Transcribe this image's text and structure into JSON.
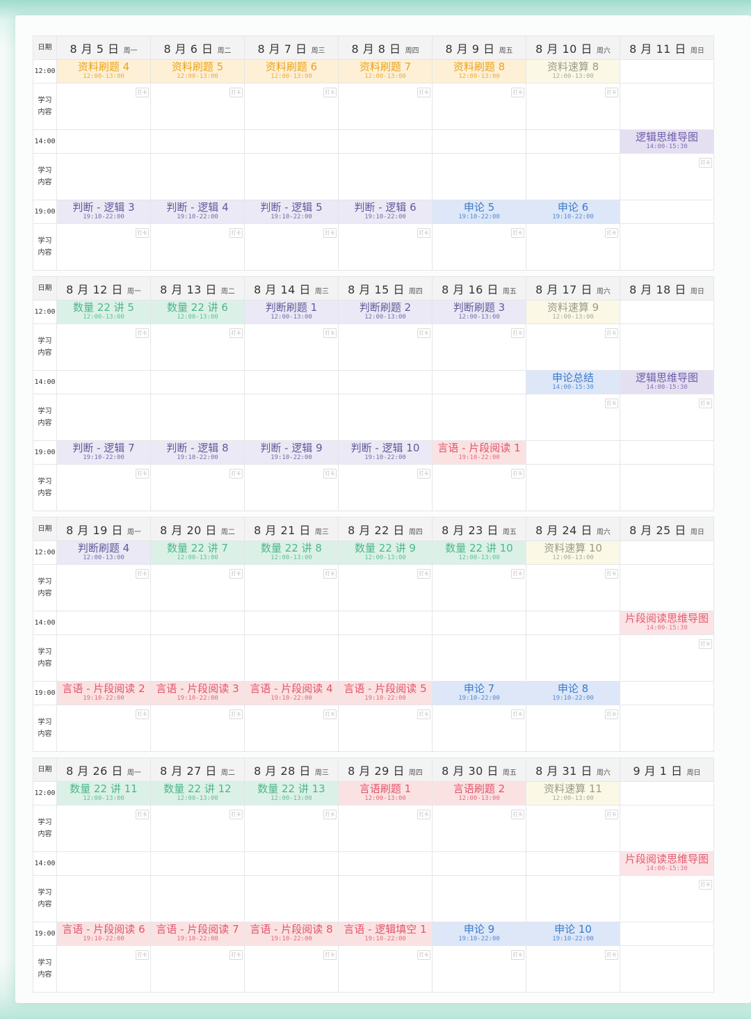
{
  "labels": {
    "date": "日期",
    "study": [
      "学习",
      "内容"
    ],
    "punch": "打卡"
  },
  "legend": {
    "resource": {
      "color": "#eda218",
      "bg": "#fdf0d6"
    },
    "speed": {
      "color": "#9a9a8c",
      "bg": "#fbf9e6"
    },
    "logic": {
      "color": "#6f5aa8",
      "bg": "#e4e0f2"
    },
    "essay": {
      "color": "#3b79c9",
      "bg": "#dde7f8"
    },
    "math": {
      "color": "#4fb58a",
      "bg": "#dbf1e7"
    },
    "judge": {
      "color": "#5f5a9a",
      "bg": "#ebe9f5"
    },
    "lang": {
      "color": "#e0556a",
      "bg": "#fbe2e2"
    },
    "mind": {
      "color": "#5a5f9c",
      "bg": "#dedcec"
    },
    "reading": {
      "color": "#e25b70",
      "bg": "#fbe3e6"
    }
  },
  "weeks": [
    {
      "days": [
        {
          "date": "8 月 5 日",
          "weekday": "周一"
        },
        {
          "date": "8 月 6 日",
          "weekday": "周二"
        },
        {
          "date": "8 月 7 日",
          "weekday": "周三"
        },
        {
          "date": "8 月 8 日",
          "weekday": "周四"
        },
        {
          "date": "8 月 9 日",
          "weekday": "周五"
        },
        {
          "date": "8 月 10 日",
          "weekday": "周六"
        },
        {
          "date": "8 月 11 日",
          "weekday": "周日"
        }
      ],
      "slots": [
        {
          "time": "12:00",
          "events": [
            {
              "title": "资料刷题 4",
              "time": "12:00-13:00",
              "cat": "resource"
            },
            {
              "title": "资料刷题 5",
              "time": "12:00-13:00",
              "cat": "resource"
            },
            {
              "title": "资料刷题 6",
              "time": "12:00-13:00",
              "cat": "resource"
            },
            {
              "title": "资料刷题 7",
              "time": "12:00-13:00",
              "cat": "resource"
            },
            {
              "title": "资料刷题 8",
              "time": "12:00-13:00",
              "cat": "resource"
            },
            {
              "title": "资料速算 8",
              "time": "12:00-13:00",
              "cat": "speed"
            },
            null
          ],
          "punch": [
            true,
            true,
            true,
            true,
            true,
            true,
            false
          ]
        },
        {
          "time": "14:00",
          "events": [
            null,
            null,
            null,
            null,
            null,
            null,
            {
              "title": "逻辑思维导图",
              "time": "14:00-15:30",
              "cat": "logic"
            }
          ],
          "punch": [
            false,
            false,
            false,
            false,
            false,
            false,
            true
          ]
        },
        {
          "time": "19:00",
          "events": [
            {
              "title": "判断 - 逻辑 3",
              "time": "19:10-22:00",
              "cat": "judge"
            },
            {
              "title": "判断 - 逻辑 4",
              "time": "19:10-22:00",
              "cat": "judge"
            },
            {
              "title": "判断 - 逻辑 5",
              "time": "19:10-22:00",
              "cat": "judge"
            },
            {
              "title": "判断 - 逻辑 6",
              "time": "19:10-22:00",
              "cat": "judge"
            },
            {
              "title": "申论 5",
              "time": "19:10-22:00",
              "cat": "essay"
            },
            {
              "title": "申论 6",
              "time": "19:10-22:00",
              "cat": "essay"
            },
            null
          ],
          "punch": [
            true,
            true,
            true,
            true,
            true,
            true,
            false
          ]
        }
      ]
    },
    {
      "days": [
        {
          "date": "8 月 12 日",
          "weekday": "周一"
        },
        {
          "date": "8 月 13 日",
          "weekday": "周二"
        },
        {
          "date": "8 月 14 日",
          "weekday": "周三"
        },
        {
          "date": "8 月 15 日",
          "weekday": "周四"
        },
        {
          "date": "8 月 16 日",
          "weekday": "周五"
        },
        {
          "date": "8 月 17 日",
          "weekday": "周六"
        },
        {
          "date": "8 月 18 日",
          "weekday": "周日"
        }
      ],
      "slots": [
        {
          "time": "12:00",
          "events": [
            {
              "title": "数量 22 讲 5",
              "time": "12:00-13:00",
              "cat": "math"
            },
            {
              "title": "数量 22 讲 6",
              "time": "12:00-13:00",
              "cat": "math"
            },
            {
              "title": "判断刷题 1",
              "time": "12:00-13:00",
              "cat": "judge"
            },
            {
              "title": "判断刷题 2",
              "time": "12:00-13:00",
              "cat": "judge"
            },
            {
              "title": "判断刷题 3",
              "time": "12:00-13:00",
              "cat": "judge"
            },
            {
              "title": "资料速算 9",
              "time": "12:00-13:00",
              "cat": "speed"
            },
            null
          ],
          "punch": [
            true,
            true,
            true,
            true,
            true,
            true,
            false
          ]
        },
        {
          "time": "14:00",
          "events": [
            null,
            null,
            null,
            null,
            null,
            {
              "title": "申论总结",
              "time": "14:00-15:30",
              "cat": "essay"
            },
            {
              "title": "逻辑思维导图",
              "time": "14:00-15:30",
              "cat": "logic"
            }
          ],
          "punch": [
            false,
            false,
            false,
            false,
            false,
            true,
            true
          ]
        },
        {
          "time": "19:00",
          "events": [
            {
              "title": "判断 - 逻辑 7",
              "time": "19:10-22:00",
              "cat": "judge"
            },
            {
              "title": "判断 - 逻辑 8",
              "time": "19:10-22:00",
              "cat": "judge"
            },
            {
              "title": "判断 - 逻辑 9",
              "time": "19:10-22:00",
              "cat": "judge"
            },
            {
              "title": "判断 - 逻辑 10",
              "time": "19:10-22:00",
              "cat": "judge"
            },
            {
              "title": "言语 - 片段阅读 1",
              "time": "19:10-22:00",
              "cat": "lang"
            },
            null,
            null
          ],
          "punch": [
            true,
            true,
            true,
            true,
            true,
            false,
            false
          ]
        }
      ]
    },
    {
      "days": [
        {
          "date": "8 月 19 日",
          "weekday": "周一"
        },
        {
          "date": "8 月 20 日",
          "weekday": "周二"
        },
        {
          "date": "8 月 21 日",
          "weekday": "周三"
        },
        {
          "date": "8 月 22 日",
          "weekday": "周四"
        },
        {
          "date": "8 月 23 日",
          "weekday": "周五"
        },
        {
          "date": "8 月 24 日",
          "weekday": "周六"
        },
        {
          "date": "8 月 25 日",
          "weekday": "周日"
        }
      ],
      "slots": [
        {
          "time": "12:00",
          "events": [
            {
              "title": "判断刷题 4",
              "time": "12:00-13:00",
              "cat": "judge"
            },
            {
              "title": "数量 22 讲 7",
              "time": "12:00-13:00",
              "cat": "math"
            },
            {
              "title": "数量 22 讲 8",
              "time": "12:00-13:00",
              "cat": "math"
            },
            {
              "title": "数量 22 讲 9",
              "time": "12:00-13:00",
              "cat": "math"
            },
            {
              "title": "数量 22 讲 10",
              "time": "12:00-13:00",
              "cat": "math"
            },
            {
              "title": "资料速算 10",
              "time": "12:00-13:00",
              "cat": "speed"
            },
            null
          ],
          "punch": [
            true,
            true,
            true,
            true,
            true,
            true,
            false
          ]
        },
        {
          "time": "14:00",
          "events": [
            null,
            null,
            null,
            null,
            null,
            null,
            {
              "title": "片段阅读思维导图",
              "time": "14:00-15:30",
              "cat": "reading"
            }
          ],
          "punch": [
            false,
            false,
            false,
            false,
            false,
            false,
            true
          ]
        },
        {
          "time": "19:00",
          "events": [
            {
              "title": "言语 - 片段阅读 2",
              "time": "19:10-22:00",
              "cat": "lang"
            },
            {
              "title": "言语 - 片段阅读 3",
              "time": "19:10-22:00",
              "cat": "lang"
            },
            {
              "title": "言语 - 片段阅读 4",
              "time": "19:10-22:00",
              "cat": "lang"
            },
            {
              "title": "言语 - 片段阅读 5",
              "time": "19:10-22:00",
              "cat": "lang"
            },
            {
              "title": "申论 7",
              "time": "19:10-22:00",
              "cat": "essay"
            },
            {
              "title": "申论 8",
              "time": "19:10-22:00",
              "cat": "essay"
            },
            null
          ],
          "punch": [
            true,
            true,
            true,
            true,
            true,
            true,
            false
          ]
        }
      ]
    },
    {
      "days": [
        {
          "date": "8 月 26 日",
          "weekday": "周一"
        },
        {
          "date": "8 月 27 日",
          "weekday": "周二"
        },
        {
          "date": "8 月 28 日",
          "weekday": "周三"
        },
        {
          "date": "8 月 29 日",
          "weekday": "周四"
        },
        {
          "date": "8 月 30 日",
          "weekday": "周五"
        },
        {
          "date": "8 月 31 日",
          "weekday": "周六"
        },
        {
          "date": "9 月 1 日",
          "weekday": "周日"
        }
      ],
      "slots": [
        {
          "time": "12:00",
          "events": [
            {
              "title": "数量 22 讲 11",
              "time": "12:00-13:00",
              "cat": "math"
            },
            {
              "title": "数量 22 讲 12",
              "time": "12:00-13:00",
              "cat": "math"
            },
            {
              "title": "数量 22 讲 13",
              "time": "12:00-13:00",
              "cat": "math"
            },
            {
              "title": "言语刷题 1",
              "time": "12:00-13:00",
              "cat": "lang"
            },
            {
              "title": "言语刷题 2",
              "time": "12:00-13:00",
              "cat": "lang"
            },
            {
              "title": "资料速算 11",
              "time": "12:00-13:00",
              "cat": "speed"
            },
            null
          ],
          "punch": [
            true,
            true,
            true,
            true,
            true,
            true,
            false
          ]
        },
        {
          "time": "14:00",
          "events": [
            null,
            null,
            null,
            null,
            null,
            null,
            {
              "title": "片段阅读思维导图",
              "time": "14:00-15:30",
              "cat": "reading"
            }
          ],
          "punch": [
            false,
            false,
            false,
            false,
            false,
            false,
            true
          ]
        },
        {
          "time": "19:00",
          "events": [
            {
              "title": "言语 - 片段阅读 6",
              "time": "19:10-22:00",
              "cat": "lang"
            },
            {
              "title": "言语 - 片段阅读 7",
              "time": "19:10-22:00",
              "cat": "lang"
            },
            {
              "title": "言语 - 片段阅读 8",
              "time": "19:10-22:00",
              "cat": "lang"
            },
            {
              "title": "言语 - 逻辑填空 1",
              "time": "19:10-22:00",
              "cat": "lang"
            },
            {
              "title": "申论 9",
              "time": "19:10-22:00",
              "cat": "essay"
            },
            {
              "title": "申论 10",
              "time": "19:10-22:00",
              "cat": "essay"
            },
            null
          ],
          "punch": [
            true,
            true,
            true,
            true,
            true,
            true,
            false
          ]
        }
      ]
    }
  ]
}
